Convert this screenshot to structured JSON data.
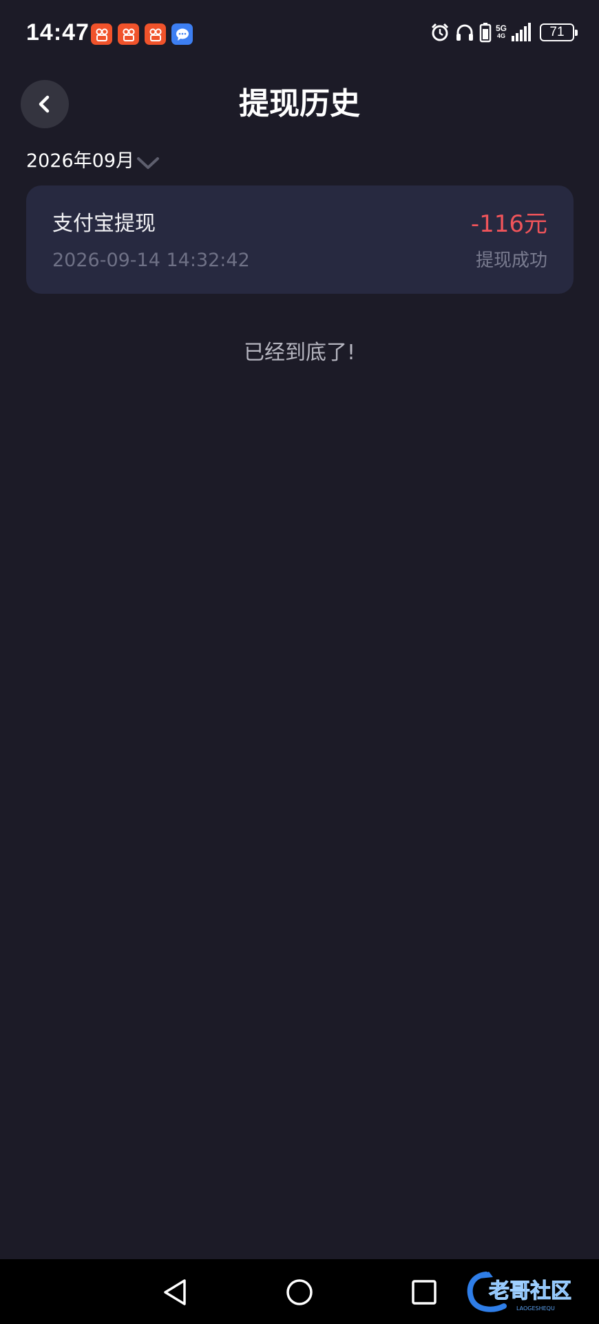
{
  "status_bar": {
    "time": "14:47",
    "network": "5G",
    "network_sub": "4G",
    "battery": "71",
    "notification_icons": [
      "kuaishou-icon",
      "kuaishou-icon",
      "kuaishou-icon",
      "message-icon"
    ],
    "system_icons": [
      "alarm-icon",
      "headphones-icon",
      "battery-saver-icon",
      "signal-icon"
    ]
  },
  "header": {
    "title": "提现历史",
    "back_icon": "chevron-left-icon"
  },
  "filter": {
    "month": "2026年09月",
    "dropdown_icon": "chevron-down-icon"
  },
  "records": [
    {
      "title": "支付宝提现",
      "time": "2026-09-14 14:32:42",
      "amount": "-116元",
      "status": "提现成功"
    }
  ],
  "end_text": "已经到底了!",
  "nav": {
    "back_icon": "triangle-back-icon",
    "home_icon": "circle-home-icon",
    "recents_icon": "square-recents-icon"
  },
  "watermark": {
    "text": "老哥社区",
    "subtext": "LAOGESHEQU"
  },
  "colors": {
    "background": "#1c1b27",
    "card": "#272940",
    "amount": "#f0545a",
    "muted": "#6f7186"
  }
}
